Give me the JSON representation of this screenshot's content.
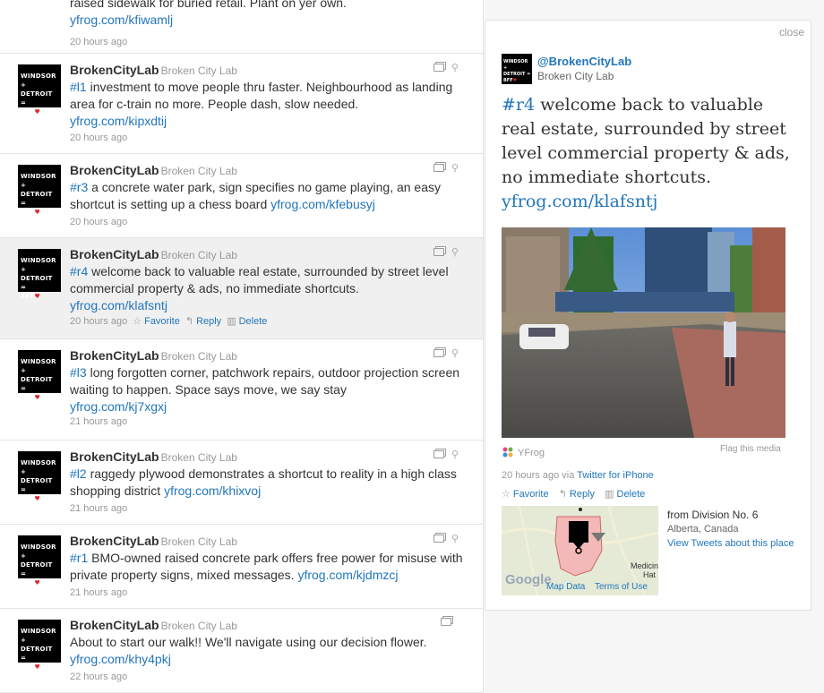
{
  "timeline": {
    "tweets": [
      {
        "name": "",
        "handle": "",
        "text_before": "raised sidewalk for buried retail. Plant on yer own.",
        "link": "yfrog.com/kfiwamlj",
        "text_after": "",
        "time": "20 hours ago",
        "has_media": false,
        "has_geo": false,
        "avatar": ""
      },
      {
        "name": "BrokenCityLab",
        "handle": "Broken City Lab",
        "tag": "#l1",
        "text_before": " investment to move people thru faster. Neighbourhood as landing area for c-train no more. People dash, slow needed.",
        "link": "yfrog.com/kipxdtij",
        "time": "20 hours ago",
        "has_media": true,
        "has_geo": true
      },
      {
        "name": "BrokenCityLab",
        "handle": "Broken City Lab",
        "tag": "#r3",
        "text_before": " a concrete water park, sign specifies no game playing, an easy shortcut is setting up a chess board ",
        "link": "yfrog.com/kfebusyj",
        "time": "20 hours ago",
        "has_media": true,
        "has_geo": true
      },
      {
        "name": "BrokenCityLab",
        "handle": "Broken City Lab",
        "tag": "#r4",
        "text_before": " welcome back to valuable real estate, surrounded by street level commercial property & ads, no immediate shortcuts.",
        "link": "yfrog.com/klafsntj",
        "time": "20 hours ago",
        "has_media": true,
        "has_geo": true,
        "selected": true
      },
      {
        "name": "BrokenCityLab",
        "handle": "Broken City Lab",
        "tag": "#l3",
        "text_before": " long forgotten corner, patchwork repairs, outdoor projection screen waiting to happen. Space says move, we say stay",
        "link": "yfrog.com/kj7xgxj",
        "time": "21 hours ago",
        "has_media": true,
        "has_geo": true
      },
      {
        "name": "BrokenCityLab",
        "handle": "Broken City Lab",
        "tag": "#l2",
        "text_before": " raggedy plywood demonstrates a shortcut to reality in a high class shopping district ",
        "link": "yfrog.com/khixvoj",
        "time": "21 hours ago",
        "has_media": true,
        "has_geo": true
      },
      {
        "name": "BrokenCityLab",
        "handle": "Broken City Lab",
        "tag": "#r1",
        "text_before": " BMO-owned raised concrete park offers free power for misuse with private property signs, mixed messages. ",
        "link": "yfrog.com/kjdmzcj",
        "time": "21 hours ago",
        "has_media": true,
        "has_geo": true
      },
      {
        "name": "BrokenCityLab",
        "handle": "Broken City Lab",
        "tag": "",
        "text_before": "About to start our walk!! We'll navigate using our decision flower.",
        "link": "yfrog.com/khy4pkj",
        "time": "22 hours ago",
        "has_media": true,
        "has_geo": false
      }
    ],
    "actions": {
      "favorite": "Favorite",
      "reply": "Reply",
      "delete": "Delete"
    },
    "avatar_lines": [
      "WINDSOR +",
      "DETROIT =",
      "BFF"
    ]
  },
  "detail": {
    "close": "close",
    "handle": "@BrokenCityLab",
    "name": "Broken City Lab",
    "tag": "#r4",
    "text": " welcome back to valuable real estate, surrounded by street level commercial property & ads, no immediate shortcuts.",
    "link": "yfrog.com/klafsntj",
    "media_source": "YFrog",
    "flag": "Flag this media",
    "time": "20 hours ago",
    "via": "via",
    "client": "Twitter for iPhone",
    "actions": {
      "favorite": "Favorite",
      "reply": "Reply",
      "delete": "Delete"
    },
    "place_from": "from Division No. 6",
    "place_region": "Alberta, Canada",
    "place_link": "View Tweets about this place",
    "map_brand": "Google",
    "map_data": "Map Data",
    "map_terms": "Terms of Use",
    "map_label_1": "Medicine",
    "map_label_2": "Hat"
  },
  "colors": {
    "link": "#2276bb",
    "heart": "#e0222a",
    "selected_bg": "#f0f0f0"
  }
}
